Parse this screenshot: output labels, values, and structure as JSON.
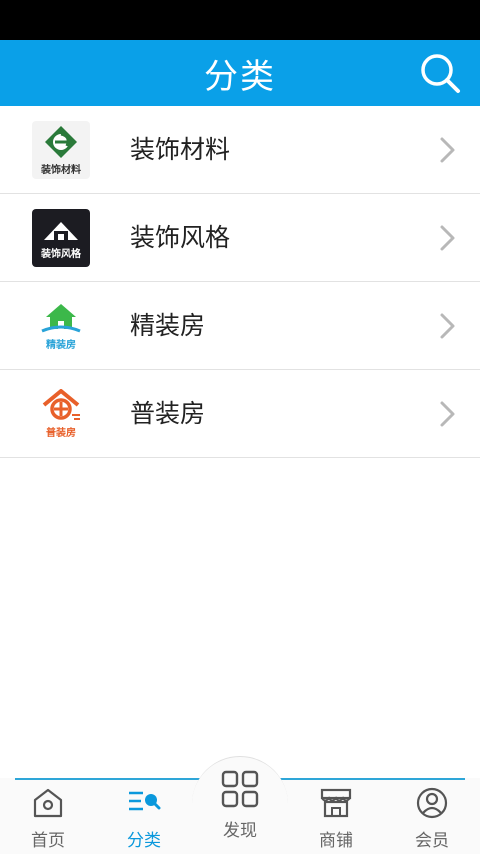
{
  "header": {
    "title": "分类"
  },
  "categories": [
    {
      "label": "装饰材料",
      "thumb_caption": "装饰材料"
    },
    {
      "label": "装饰风格",
      "thumb_caption": "装饰风格"
    },
    {
      "label": "精装房",
      "thumb_caption": "精装房"
    },
    {
      "label": "普装房",
      "thumb_caption": "普装房"
    }
  ],
  "tabbar": {
    "home": "首页",
    "category": "分类",
    "discover": "发现",
    "shops": "商铺",
    "member": "会员"
  },
  "colors": {
    "accent": "#0aa0e8",
    "active_tab": "#0a98dc"
  }
}
